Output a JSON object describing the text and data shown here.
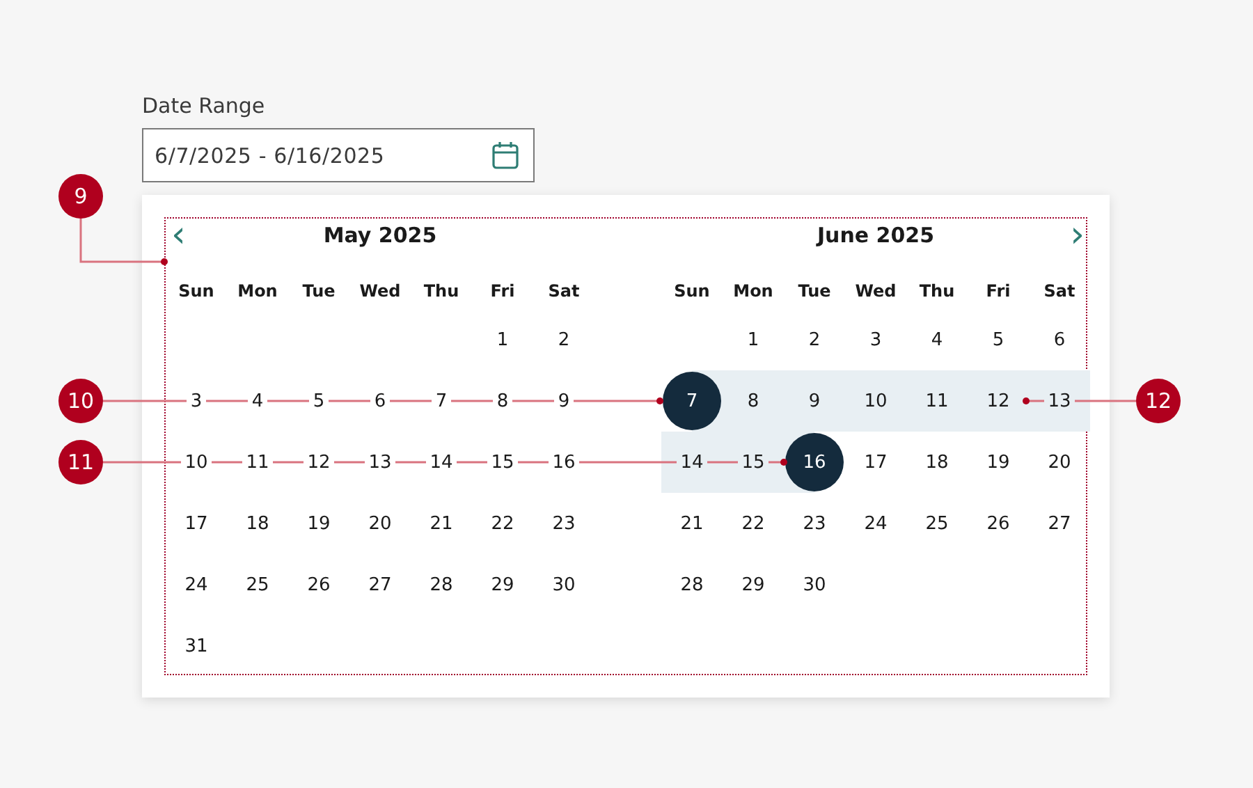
{
  "date_range": {
    "label": "Date Range",
    "value": "6/7/2025 - 6/16/2025"
  },
  "nav": {
    "previous": "‹",
    "next": "›"
  },
  "months": [
    {
      "title": "May 2025",
      "weekdays": [
        "Sun",
        "Mon",
        "Tue",
        "Wed",
        "Thu",
        "Fri",
        "Sat"
      ],
      "weeks": [
        [
          {
            "kind": "blank"
          },
          {
            "kind": "blank"
          },
          {
            "kind": "blank"
          },
          {
            "kind": "blank"
          },
          {
            "kind": "blank"
          },
          {
            "kind": "day",
            "day": "1",
            "selected": false,
            "in_range": false
          },
          {
            "kind": "day",
            "day": "2",
            "selected": false,
            "in_range": false
          }
        ],
        [
          {
            "kind": "day",
            "day": "3",
            "selected": false,
            "in_range": false
          },
          {
            "kind": "day",
            "day": "4",
            "selected": false,
            "in_range": false
          },
          {
            "kind": "day",
            "day": "5",
            "selected": false,
            "in_range": false
          },
          {
            "kind": "day",
            "day": "6",
            "selected": false,
            "in_range": false
          },
          {
            "kind": "day",
            "day": "7",
            "selected": false,
            "in_range": false
          },
          {
            "kind": "day",
            "day": "8",
            "selected": false,
            "in_range": false
          },
          {
            "kind": "day",
            "day": "9",
            "selected": false,
            "in_range": false
          }
        ],
        [
          {
            "kind": "day",
            "day": "10",
            "selected": false,
            "in_range": false
          },
          {
            "kind": "day",
            "day": "11",
            "selected": false,
            "in_range": false
          },
          {
            "kind": "day",
            "day": "12",
            "selected": false,
            "in_range": false
          },
          {
            "kind": "day",
            "day": "13",
            "selected": false,
            "in_range": false
          },
          {
            "kind": "day",
            "day": "14",
            "selected": false,
            "in_range": false
          },
          {
            "kind": "day",
            "day": "15",
            "selected": false,
            "in_range": false
          },
          {
            "kind": "day",
            "day": "16",
            "selected": false,
            "in_range": false
          }
        ],
        [
          {
            "kind": "day",
            "day": "17",
            "selected": false,
            "in_range": false
          },
          {
            "kind": "day",
            "day": "18",
            "selected": false,
            "in_range": false
          },
          {
            "kind": "day",
            "day": "19",
            "selected": false,
            "in_range": false
          },
          {
            "kind": "day",
            "day": "20",
            "selected": false,
            "in_range": false
          },
          {
            "kind": "day",
            "day": "21",
            "selected": false,
            "in_range": false
          },
          {
            "kind": "day",
            "day": "22",
            "selected": false,
            "in_range": false
          },
          {
            "kind": "day",
            "day": "23",
            "selected": false,
            "in_range": false
          }
        ],
        [
          {
            "kind": "day",
            "day": "24",
            "selected": false,
            "in_range": false
          },
          {
            "kind": "day",
            "day": "25",
            "selected": false,
            "in_range": false
          },
          {
            "kind": "day",
            "day": "26",
            "selected": false,
            "in_range": false
          },
          {
            "kind": "day",
            "day": "27",
            "selected": false,
            "in_range": false
          },
          {
            "kind": "day",
            "day": "28",
            "selected": false,
            "in_range": false
          },
          {
            "kind": "day",
            "day": "29",
            "selected": false,
            "in_range": false
          },
          {
            "kind": "day",
            "day": "30",
            "selected": false,
            "in_range": false
          }
        ],
        [
          {
            "kind": "day",
            "day": "31",
            "selected": false,
            "in_range": false
          }
        ]
      ]
    },
    {
      "title": "June 2025",
      "weekdays": [
        "Sun",
        "Mon",
        "Tue",
        "Wed",
        "Thu",
        "Fri",
        "Sat"
      ],
      "weeks": [
        [
          {
            "kind": "blank"
          },
          {
            "kind": "day",
            "day": "1",
            "selected": false,
            "in_range": false
          },
          {
            "kind": "day",
            "day": "2",
            "selected": false,
            "in_range": false
          },
          {
            "kind": "day",
            "day": "3",
            "selected": false,
            "in_range": false
          },
          {
            "kind": "day",
            "day": "4",
            "selected": false,
            "in_range": false
          },
          {
            "kind": "day",
            "day": "5",
            "selected": false,
            "in_range": false
          },
          {
            "kind": "day",
            "day": "6",
            "selected": false,
            "in_range": false
          }
        ],
        [
          {
            "kind": "day",
            "day": "7",
            "selected": true,
            "in_range": true
          },
          {
            "kind": "day",
            "day": "8",
            "selected": false,
            "in_range": true
          },
          {
            "kind": "day",
            "day": "9",
            "selected": false,
            "in_range": true
          },
          {
            "kind": "day",
            "day": "10",
            "selected": false,
            "in_range": true
          },
          {
            "kind": "day",
            "day": "11",
            "selected": false,
            "in_range": true
          },
          {
            "kind": "day",
            "day": "12",
            "selected": false,
            "in_range": true
          },
          {
            "kind": "day",
            "day": "13",
            "selected": false,
            "in_range": true
          }
        ],
        [
          {
            "kind": "day",
            "day": "14",
            "selected": false,
            "in_range": true
          },
          {
            "kind": "day",
            "day": "15",
            "selected": false,
            "in_range": true
          },
          {
            "kind": "day",
            "day": "16",
            "selected": true,
            "in_range": true
          },
          {
            "kind": "day",
            "day": "17",
            "selected": false,
            "in_range": false
          },
          {
            "kind": "day",
            "day": "18",
            "selected": false,
            "in_range": false
          },
          {
            "kind": "day",
            "day": "19",
            "selected": false,
            "in_range": false
          },
          {
            "kind": "day",
            "day": "20",
            "selected": false,
            "in_range": false
          }
        ],
        [
          {
            "kind": "day",
            "day": "21",
            "selected": false,
            "in_range": false
          },
          {
            "kind": "day",
            "day": "22",
            "selected": false,
            "in_range": false
          },
          {
            "kind": "day",
            "day": "23",
            "selected": false,
            "in_range": false
          },
          {
            "kind": "day",
            "day": "24",
            "selected": false,
            "in_range": false
          },
          {
            "kind": "day",
            "day": "25",
            "selected": false,
            "in_range": false
          },
          {
            "kind": "day",
            "day": "26",
            "selected": false,
            "in_range": false
          },
          {
            "kind": "day",
            "day": "27",
            "selected": false,
            "in_range": false
          }
        ],
        [
          {
            "kind": "day",
            "day": "28",
            "selected": false,
            "in_range": false
          },
          {
            "kind": "day",
            "day": "29",
            "selected": false,
            "in_range": false
          },
          {
            "kind": "day",
            "day": "30",
            "selected": false,
            "in_range": false
          }
        ]
      ]
    }
  ],
  "callouts": [
    {
      "number": "9"
    },
    {
      "number": "10"
    },
    {
      "number": "11"
    },
    {
      "number": "12"
    }
  ]
}
